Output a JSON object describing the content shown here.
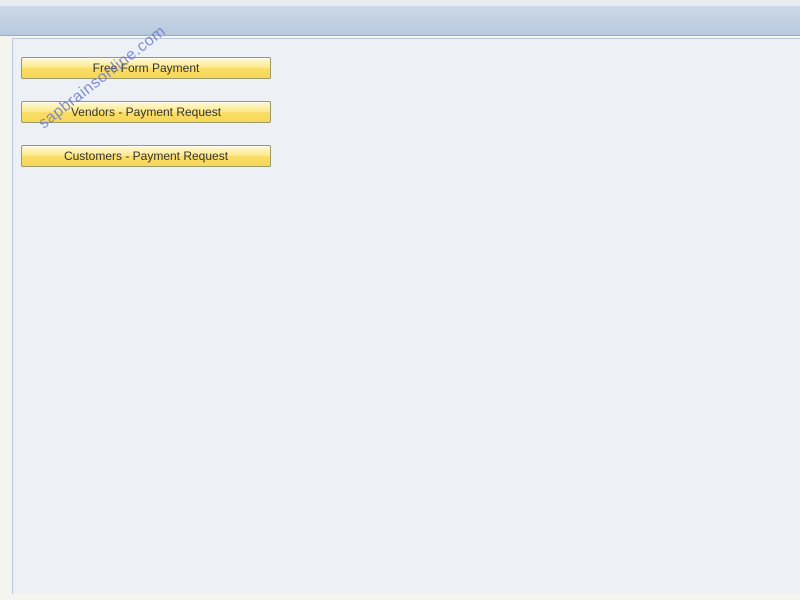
{
  "buttons": {
    "free_form": "Free Form Payment",
    "vendors": "Vendors - Payment Request",
    "customers": "Customers - Payment Request"
  },
  "watermark": "sapbrainsonline.com"
}
